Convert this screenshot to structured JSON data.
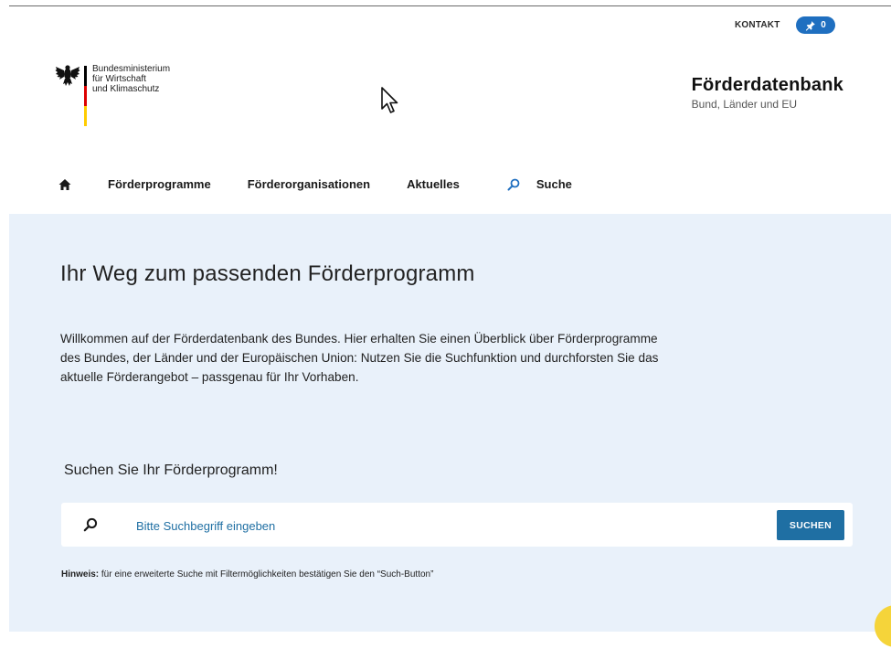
{
  "header": {
    "kontakt_label": "KONTAKT",
    "pin_count": "0",
    "ministry_lines": [
      "Bundesministerium",
      "für Wirtschaft",
      "und Klimaschutz"
    ],
    "brand_title": "Förderdatenbank",
    "brand_subtitle": "Bund, Länder und EU"
  },
  "nav": {
    "items": [
      "Förderprogramme",
      "Förderorganisationen",
      "Aktuelles"
    ],
    "search_label": "Suche"
  },
  "hero": {
    "title": "Ihr Weg zum passenden Förderprogramm",
    "intro": "Willkommen auf der Förderdatenbank des Bundes. Hier erhalten Sie einen Überblick über Förderprogramme des Bundes, der Länder und der Europäischen Union: Nutzen Sie die Suchfunktion und durchforsten Sie das aktuelle Förderangebot – passgenau für Ihr Vorhaben.",
    "search_heading": "Suchen Sie Ihr Förderprogramm!",
    "search_placeholder": "Bitte Suchbegriff eingeben",
    "search_value": "",
    "search_button": "SUCHEN",
    "hint_label": "Hinweis:",
    "hint_text": " für eine erweiterte Suche mit Filtermöglichkeiten bestätigen Sie den “Such-Button”"
  },
  "colors": {
    "accent": "#1f6fa3",
    "pin_badge": "#1f6fc0",
    "hero_bg": "#e9f1fa",
    "flag_black": "#000000",
    "flag_red": "#dd0000",
    "flag_gold": "#ffcc00",
    "fab": "#f5d43a"
  },
  "icons": {
    "pin": "pin-icon",
    "home": "home-icon",
    "search": "search-icon",
    "eagle": "federal-eagle-icon",
    "cursor": "mouse-cursor-icon"
  }
}
